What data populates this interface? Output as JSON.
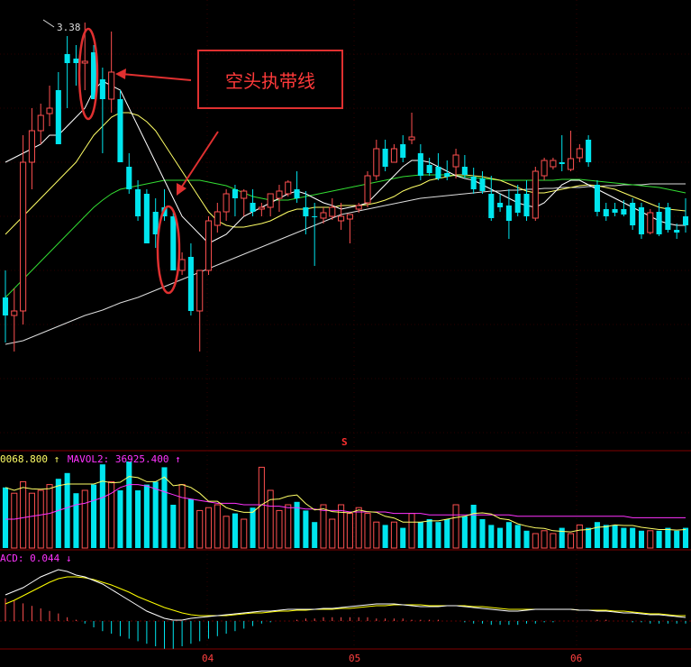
{
  "annotations": {
    "box_text": "空头执带线",
    "high_price_label": "3.38",
    "marker": "S"
  },
  "indicators": {
    "mavol1": "0068.800",
    "mavol1_arrow": "↑",
    "mavol2_label": "MAVOL2: 36925.400",
    "mavol2_arrow": "↑",
    "macd_label": "ACD: 0.044",
    "macd_arrow": "↓"
  },
  "colors": {
    "up": "#ff5050",
    "down": "#00e5ee",
    "ma5": "#ffffff",
    "ma10": "#ffff66",
    "ma20": "#33dd33",
    "ma60": "#dddddd",
    "mavol2": "#ff33ff",
    "dif": "#ffffff",
    "dea": "#ffff00",
    "annotation": "#e03030"
  },
  "chart_data": {
    "type": "candlestick",
    "x_ticks": [
      "04",
      "05",
      "06"
    ],
    "candles": [
      {
        "o": 330,
        "h": 300,
        "l": 380,
        "c": 350
      },
      {
        "o": 350,
        "h": 320,
        "l": 390,
        "c": 345
      },
      {
        "o": 345,
        "h": 150,
        "l": 360,
        "c": 180
      },
      {
        "o": 180,
        "h": 120,
        "l": 210,
        "c": 145
      },
      {
        "o": 145,
        "h": 115,
        "l": 160,
        "c": 128
      },
      {
        "o": 126,
        "h": 95,
        "l": 140,
        "c": 120
      },
      {
        "o": 100,
        "h": 80,
        "l": 160,
        "c": 160
      },
      {
        "o": 60,
        "h": 40,
        "l": 120,
        "c": 70
      },
      {
        "o": 65,
        "h": 50,
        "l": 95,
        "c": 70
      },
      {
        "o": 70,
        "h": 25,
        "l": 100,
        "c": 68
      },
      {
        "o": 58,
        "h": 50,
        "l": 110,
        "c": 110
      },
      {
        "o": 88,
        "h": 75,
        "l": 170,
        "c": 110
      },
      {
        "o": 110,
        "h": 35,
        "l": 125,
        "c": 80
      },
      {
        "o": 110,
        "h": 100,
        "l": 180,
        "c": 180
      },
      {
        "o": 185,
        "h": 170,
        "l": 215,
        "c": 210
      },
      {
        "o": 210,
        "h": 200,
        "l": 245,
        "c": 240
      },
      {
        "o": 215,
        "h": 210,
        "l": 270,
        "c": 270
      },
      {
        "o": 235,
        "h": 220,
        "l": 275,
        "c": 260
      },
      {
        "o": 230,
        "h": 210,
        "l": 245,
        "c": 240
      },
      {
        "o": 240,
        "h": 235,
        "l": 300,
        "c": 300
      },
      {
        "o": 300,
        "h": 280,
        "l": 305,
        "c": 288
      },
      {
        "o": 285,
        "h": 270,
        "l": 350,
        "c": 345
      },
      {
        "o": 345,
        "h": 300,
        "l": 390,
        "c": 300
      },
      {
        "o": 300,
        "h": 240,
        "l": 305,
        "c": 245
      },
      {
        "o": 250,
        "h": 225,
        "l": 258,
        "c": 235
      },
      {
        "o": 235,
        "h": 210,
        "l": 245,
        "c": 215
      },
      {
        "o": 210,
        "h": 205,
        "l": 240,
        "c": 220
      },
      {
        "o": 220,
        "h": 210,
        "l": 240,
        "c": 212
      },
      {
        "o": 225,
        "h": 210,
        "l": 240,
        "c": 235
      },
      {
        "o": 232,
        "h": 225,
        "l": 240,
        "c": 230
      },
      {
        "o": 230,
        "h": 215,
        "l": 240,
        "c": 215
      },
      {
        "o": 220,
        "h": 205,
        "l": 235,
        "c": 212
      },
      {
        "o": 215,
        "h": 200,
        "l": 218,
        "c": 202
      },
      {
        "o": 210,
        "h": 190,
        "l": 225,
        "c": 220
      },
      {
        "o": 230,
        "h": 212,
        "l": 260,
        "c": 240
      },
      {
        "o": 240,
        "h": 225,
        "l": 295,
        "c": 240
      },
      {
        "o": 242,
        "h": 230,
        "l": 248,
        "c": 236
      },
      {
        "o": 240,
        "h": 220,
        "l": 244,
        "c": 230
      },
      {
        "o": 245,
        "h": 225,
        "l": 255,
        "c": 240
      },
      {
        "o": 243,
        "h": 238,
        "l": 270,
        "c": 238
      },
      {
        "o": 232,
        "h": 225,
        "l": 236,
        "c": 228
      },
      {
        "o": 225,
        "h": 190,
        "l": 230,
        "c": 195
      },
      {
        "o": 195,
        "h": 155,
        "l": 200,
        "c": 165
      },
      {
        "o": 165,
        "h": 155,
        "l": 190,
        "c": 185
      },
      {
        "o": 180,
        "h": 160,
        "l": 175,
        "c": 165
      },
      {
        "o": 160,
        "h": 150,
        "l": 180,
        "c": 175
      },
      {
        "o": 155,
        "h": 125,
        "l": 160,
        "c": 152
      },
      {
        "o": 170,
        "h": 160,
        "l": 200,
        "c": 195
      },
      {
        "o": 183,
        "h": 175,
        "l": 195,
        "c": 192
      },
      {
        "o": 185,
        "h": 170,
        "l": 200,
        "c": 198
      },
      {
        "o": 192,
        "h": 178,
        "l": 200,
        "c": 196
      },
      {
        "o": 185,
        "h": 165,
        "l": 198,
        "c": 172
      },
      {
        "o": 185,
        "h": 172,
        "l": 198,
        "c": 194
      },
      {
        "o": 196,
        "h": 186,
        "l": 215,
        "c": 210
      },
      {
        "o": 198,
        "h": 190,
        "l": 215,
        "c": 212
      },
      {
        "o": 215,
        "h": 195,
        "l": 245,
        "c": 242
      },
      {
        "o": 225,
        "h": 215,
        "l": 235,
        "c": 230
      },
      {
        "o": 228,
        "h": 210,
        "l": 265,
        "c": 245
      },
      {
        "o": 215,
        "h": 205,
        "l": 240,
        "c": 236
      },
      {
        "o": 215,
        "h": 200,
        "l": 245,
        "c": 240
      },
      {
        "o": 242,
        "h": 185,
        "l": 245,
        "c": 190
      },
      {
        "o": 195,
        "h": 175,
        "l": 200,
        "c": 178
      },
      {
        "o": 185,
        "h": 175,
        "l": 188,
        "c": 178
      },
      {
        "o": 180,
        "h": 150,
        "l": 190,
        "c": 182
      },
      {
        "o": 188,
        "h": 145,
        "l": 190,
        "c": 176
      },
      {
        "o": 175,
        "h": 160,
        "l": 180,
        "c": 165
      },
      {
        "o": 155,
        "h": 150,
        "l": 185,
        "c": 180
      },
      {
        "o": 205,
        "h": 200,
        "l": 240,
        "c": 235
      },
      {
        "o": 232,
        "h": 225,
        "l": 245,
        "c": 240
      },
      {
        "o": 232,
        "h": 225,
        "l": 240,
        "c": 236
      },
      {
        "o": 232,
        "h": 222,
        "l": 240,
        "c": 238
      },
      {
        "o": 225,
        "h": 220,
        "l": 255,
        "c": 250
      },
      {
        "o": 230,
        "h": 225,
        "l": 265,
        "c": 260
      },
      {
        "o": 258,
        "h": 232,
        "l": 260,
        "c": 236
      },
      {
        "o": 235,
        "h": 225,
        "l": 262,
        "c": 260
      },
      {
        "o": 230,
        "h": 225,
        "l": 258,
        "c": 255
      },
      {
        "o": 255,
        "h": 248,
        "l": 265,
        "c": 258
      },
      {
        "o": 240,
        "h": 220,
        "l": 258,
        "c": 250
      }
    ],
    "ma5": [
      180,
      175,
      170,
      165,
      160,
      150,
      150,
      140,
      130,
      120,
      100,
      90,
      95,
      100,
      120,
      140,
      160,
      180,
      200,
      220,
      240,
      250,
      260,
      270,
      265,
      260,
      250,
      240,
      235,
      230,
      225,
      220,
      215,
      212,
      215,
      220,
      225,
      228,
      232,
      230,
      228,
      225,
      215,
      205,
      195,
      185,
      178,
      178,
      180,
      185,
      190,
      195,
      198,
      200,
      205,
      210,
      215,
      220,
      225,
      228,
      230,
      225,
      215,
      205,
      200,
      200,
      205,
      210,
      215,
      220,
      225,
      230,
      235,
      240,
      245,
      248,
      250,
      250
    ],
    "ma10": [
      260,
      250,
      240,
      230,
      220,
      210,
      200,
      190,
      180,
      165,
      150,
      140,
      130,
      125,
      125,
      128,
      135,
      145,
      160,
      175,
      190,
      205,
      220,
      235,
      245,
      250,
      252,
      252,
      250,
      248,
      245,
      240,
      235,
      232,
      232,
      230,
      230,
      230,
      228,
      228,
      228,
      227,
      225,
      222,
      218,
      212,
      208,
      205,
      200,
      198,
      196,
      194,
      194,
      195,
      196,
      198,
      200,
      204,
      208,
      212,
      214,
      214,
      212,
      210,
      208,
      206,
      205,
      206,
      208,
      210,
      214,
      218,
      222,
      226,
      230,
      232,
      233,
      234
    ],
    "ma20": [
      330,
      320,
      310,
      300,
      290,
      280,
      270,
      260,
      250,
      240,
      230,
      222,
      215,
      210,
      208,
      206,
      204,
      202,
      200,
      200,
      200,
      200,
      200,
      202,
      204,
      206,
      210,
      214,
      218,
      220,
      222,
      222,
      222,
      220,
      218,
      216,
      214,
      212,
      210,
      208,
      206,
      204,
      202,
      200,
      198,
      196,
      195,
      194,
      194,
      194,
      194,
      195,
      196,
      197,
      198,
      199,
      200,
      200,
      200,
      200,
      200,
      200,
      200,
      199,
      199,
      199,
      200,
      201,
      202,
      203,
      204,
      205,
      206,
      207,
      208,
      210,
      212,
      214
    ],
    "ma60": [
      382,
      380,
      378,
      374,
      370,
      366,
      362,
      358,
      354,
      350,
      347,
      344,
      340,
      336,
      333,
      330,
      326,
      322,
      318,
      314,
      310,
      306,
      302,
      298,
      294,
      290,
      286,
      282,
      278,
      274,
      270,
      266,
      262,
      258,
      254,
      250,
      246,
      242,
      238,
      236,
      234,
      232,
      230,
      228,
      226,
      224,
      222,
      220,
      219,
      218,
      217,
      216,
      215,
      214,
      213,
      212,
      212,
      211,
      211,
      210,
      210,
      209,
      209,
      208,
      208,
      208,
      207,
      207,
      206,
      206,
      205,
      205,
      205,
      204,
      204,
      204,
      204,
      204
    ],
    "mavol2": [
      20,
      20,
      21,
      22,
      23,
      24,
      26,
      28,
      30,
      31,
      33,
      35,
      38,
      42,
      44,
      44,
      43,
      41,
      39,
      37,
      35,
      34,
      33,
      32,
      31,
      31,
      31,
      30,
      30,
      30,
      29,
      29,
      28,
      28,
      27,
      27,
      26,
      26,
      26,
      25,
      25,
      25,
      25,
      25,
      24,
      24,
      24,
      24,
      23,
      23,
      23,
      23,
      23,
      23,
      23,
      23,
      23,
      23,
      22,
      22,
      22,
      22,
      22,
      22,
      22,
      22,
      22,
      22,
      22,
      22,
      22,
      21,
      21,
      21,
      21,
      21,
      21,
      21
    ],
    "volumes": [
      42,
      38,
      46,
      38,
      40,
      44,
      48,
      52,
      38,
      40,
      44,
      58,
      46,
      40,
      60,
      40,
      44,
      46,
      56,
      30,
      44,
      34,
      26,
      28,
      30,
      22,
      24,
      20,
      28,
      56,
      40,
      26,
      30,
      32,
      26,
      18,
      30,
      20,
      30,
      24,
      28,
      24,
      18,
      16,
      18,
      14,
      24,
      18,
      20,
      18,
      20,
      30,
      22,
      30,
      20,
      16,
      14,
      18,
      16,
      12,
      10,
      12,
      10,
      14,
      10,
      16,
      14,
      18,
      16,
      16,
      14,
      14,
      12,
      12,
      12,
      14,
      12,
      14
    ],
    "macd": [
      18,
      16,
      14,
      12,
      10,
      8,
      6,
      3,
      1,
      -2,
      -5,
      -8,
      -10,
      -12,
      -14,
      -16,
      -18,
      -20,
      -22,
      -22,
      -20,
      -18,
      -16,
      -14,
      -12,
      -10,
      -8,
      -6,
      -4,
      -2,
      -1,
      0,
      0,
      1,
      2,
      2,
      3,
      3,
      3,
      3,
      3,
      3,
      2,
      2,
      2,
      2,
      1,
      1,
      1,
      1,
      0,
      0,
      -1,
      -2,
      -2,
      -3,
      -3,
      -3,
      -3,
      -2,
      -2,
      -1,
      -1,
      0,
      0,
      0,
      0,
      1,
      1,
      0,
      0,
      -1,
      -1,
      -2,
      -2,
      -2,
      -2,
      -2
    ],
    "dif": [
      660,
      656,
      652,
      646,
      640,
      636,
      632,
      634,
      638,
      640,
      644,
      648,
      654,
      660,
      666,
      672,
      678,
      682,
      686,
      688,
      688,
      686,
      685,
      684,
      683,
      682,
      681,
      680,
      679,
      678,
      678,
      677,
      676,
      676,
      676,
      676,
      675,
      675,
      674,
      673,
      672,
      671,
      670,
      670,
      670,
      671,
      672,
      673,
      673,
      673,
      672,
      672,
      673,
      674,
      675,
      676,
      677,
      678,
      678,
      677,
      676,
      676,
      676,
      676,
      676,
      677,
      677,
      678,
      678,
      679,
      680,
      680,
      681,
      682,
      682,
      683,
      684,
      685
    ],
    "dea": [
      670,
      666,
      661,
      656,
      651,
      646,
      642,
      640,
      640,
      641,
      643,
      646,
      649,
      653,
      657,
      662,
      666,
      670,
      674,
      677,
      680,
      682,
      683,
      683,
      683,
      683,
      682,
      681,
      680,
      680,
      679,
      678,
      678,
      677,
      677,
      676,
      676,
      676,
      675,
      675,
      674,
      673,
      672,
      672,
      671,
      671,
      671,
      671,
      672,
      672,
      672,
      672,
      672,
      673,
      673,
      674,
      675,
      676,
      676,
      676,
      676,
      676,
      676,
      676,
      676,
      677,
      677,
      677,
      677,
      678,
      678,
      679,
      680,
      681,
      681,
      682,
      683,
      683
    ]
  }
}
